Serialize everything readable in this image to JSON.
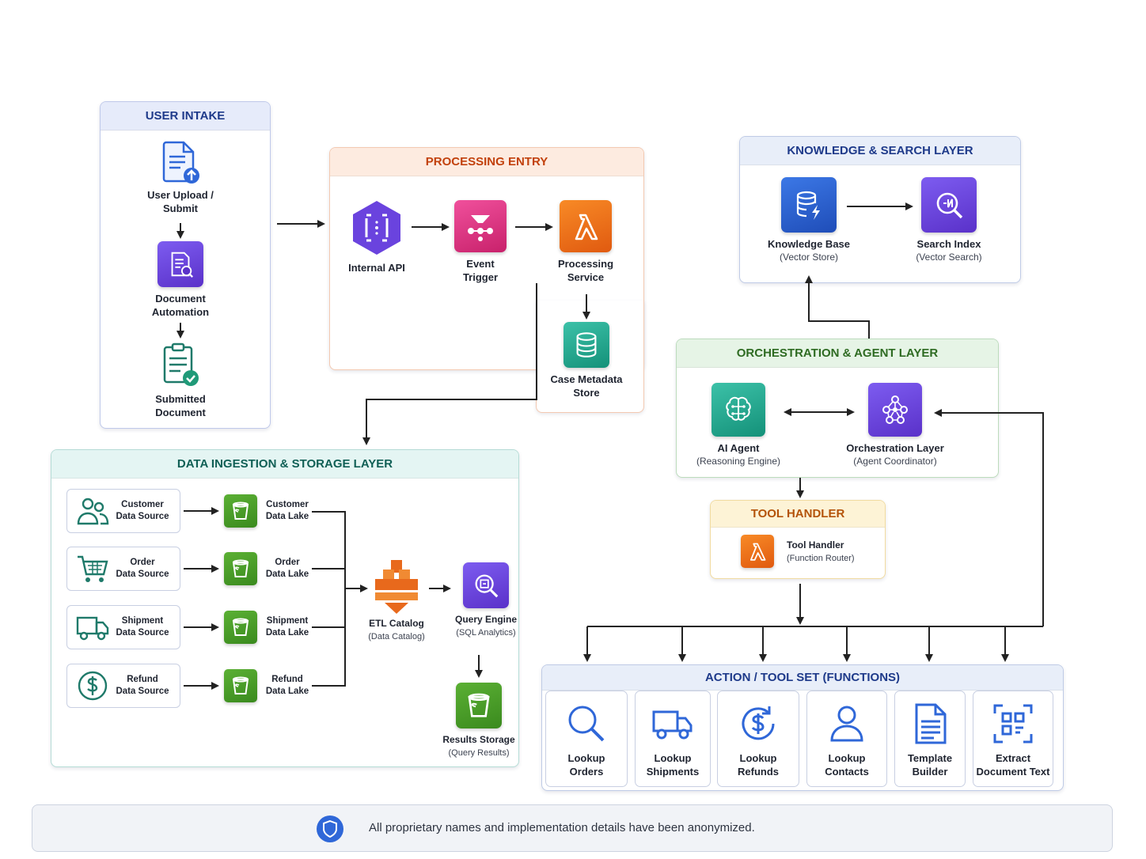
{
  "panels": {
    "user_intake": "USER INTAKE",
    "processing_entry": "PROCESSING ENTRY",
    "knowledge_search": "KNOWLEDGE & SEARCH LAYER",
    "orchestration": "ORCHESTRATION & AGENT LAYER",
    "tool_handler": "TOOL HANDLER",
    "data_ingestion": "DATA INGESTION & STORAGE LAYER",
    "action_toolset": "ACTION / TOOL SET (FUNCTIONS)"
  },
  "user_intake": {
    "upload": "User Upload /\nSubmit",
    "automation": "Document\nAutomation",
    "submitted": "Submitted\nDocument"
  },
  "processing": {
    "internal_api": "Internal API",
    "event_trigger": "Event\nTrigger",
    "processing_service": "Processing\nService",
    "case_metadata": "Case Metadata\nStore"
  },
  "knowledge": {
    "kb_title": "Knowledge Base",
    "kb_sub": "(Vector Store)",
    "search_title": "Search Index",
    "search_sub": "(Vector Search)"
  },
  "orchestration": {
    "agent_title": "AI Agent",
    "agent_sub": "(Reasoning Engine)",
    "layer_title": "Orchestration Layer",
    "layer_sub": "(Agent Coordinator)"
  },
  "tool_handler": {
    "title": "Tool Handler",
    "sub": "(Function Router)"
  },
  "ingestion": {
    "sources": [
      "Customer\nData Source",
      "Order\nData Source",
      "Shipment\nData Source",
      "Refund\nData Source"
    ],
    "lakes": [
      "Customer\nData Lake",
      "Order\nData Lake",
      "Shipment\nData Lake",
      "Refund\nData Lake"
    ],
    "etl_title": "ETL Catalog",
    "etl_sub": "(Data Catalog)",
    "query_title": "Query Engine",
    "query_sub": "(SQL Analytics)",
    "results_title": "Results Storage",
    "results_sub": "(Query Results)"
  },
  "tools": [
    "Lookup\nOrders",
    "Lookup\nShipments",
    "Lookup\nRefunds",
    "Lookup\nContacts",
    "Template\nBuilder",
    "Extract\nDocument Text"
  ],
  "footer": {
    "text": "All proprietary names and implementation details have been anonymized."
  },
  "colors": {
    "user_intake_head": "#e6ebfa",
    "processing_head": "#fdebe0",
    "processing_title": "#c2410c",
    "knowledge_head": "#e8eef9",
    "knowledge_title": "#1e3a8a",
    "orchestration_head": "#e6f4e6",
    "orchestration_title": "#2e6b22",
    "tool_handler_head": "#fdf3d6",
    "tool_handler_title": "#b45309",
    "ingestion_head": "#e4f5f3",
    "ingestion_title": "#0f5f55",
    "action_head": "#e8eef9",
    "action_title": "#1e3a8a",
    "icon_blue": "#2f67d8"
  }
}
